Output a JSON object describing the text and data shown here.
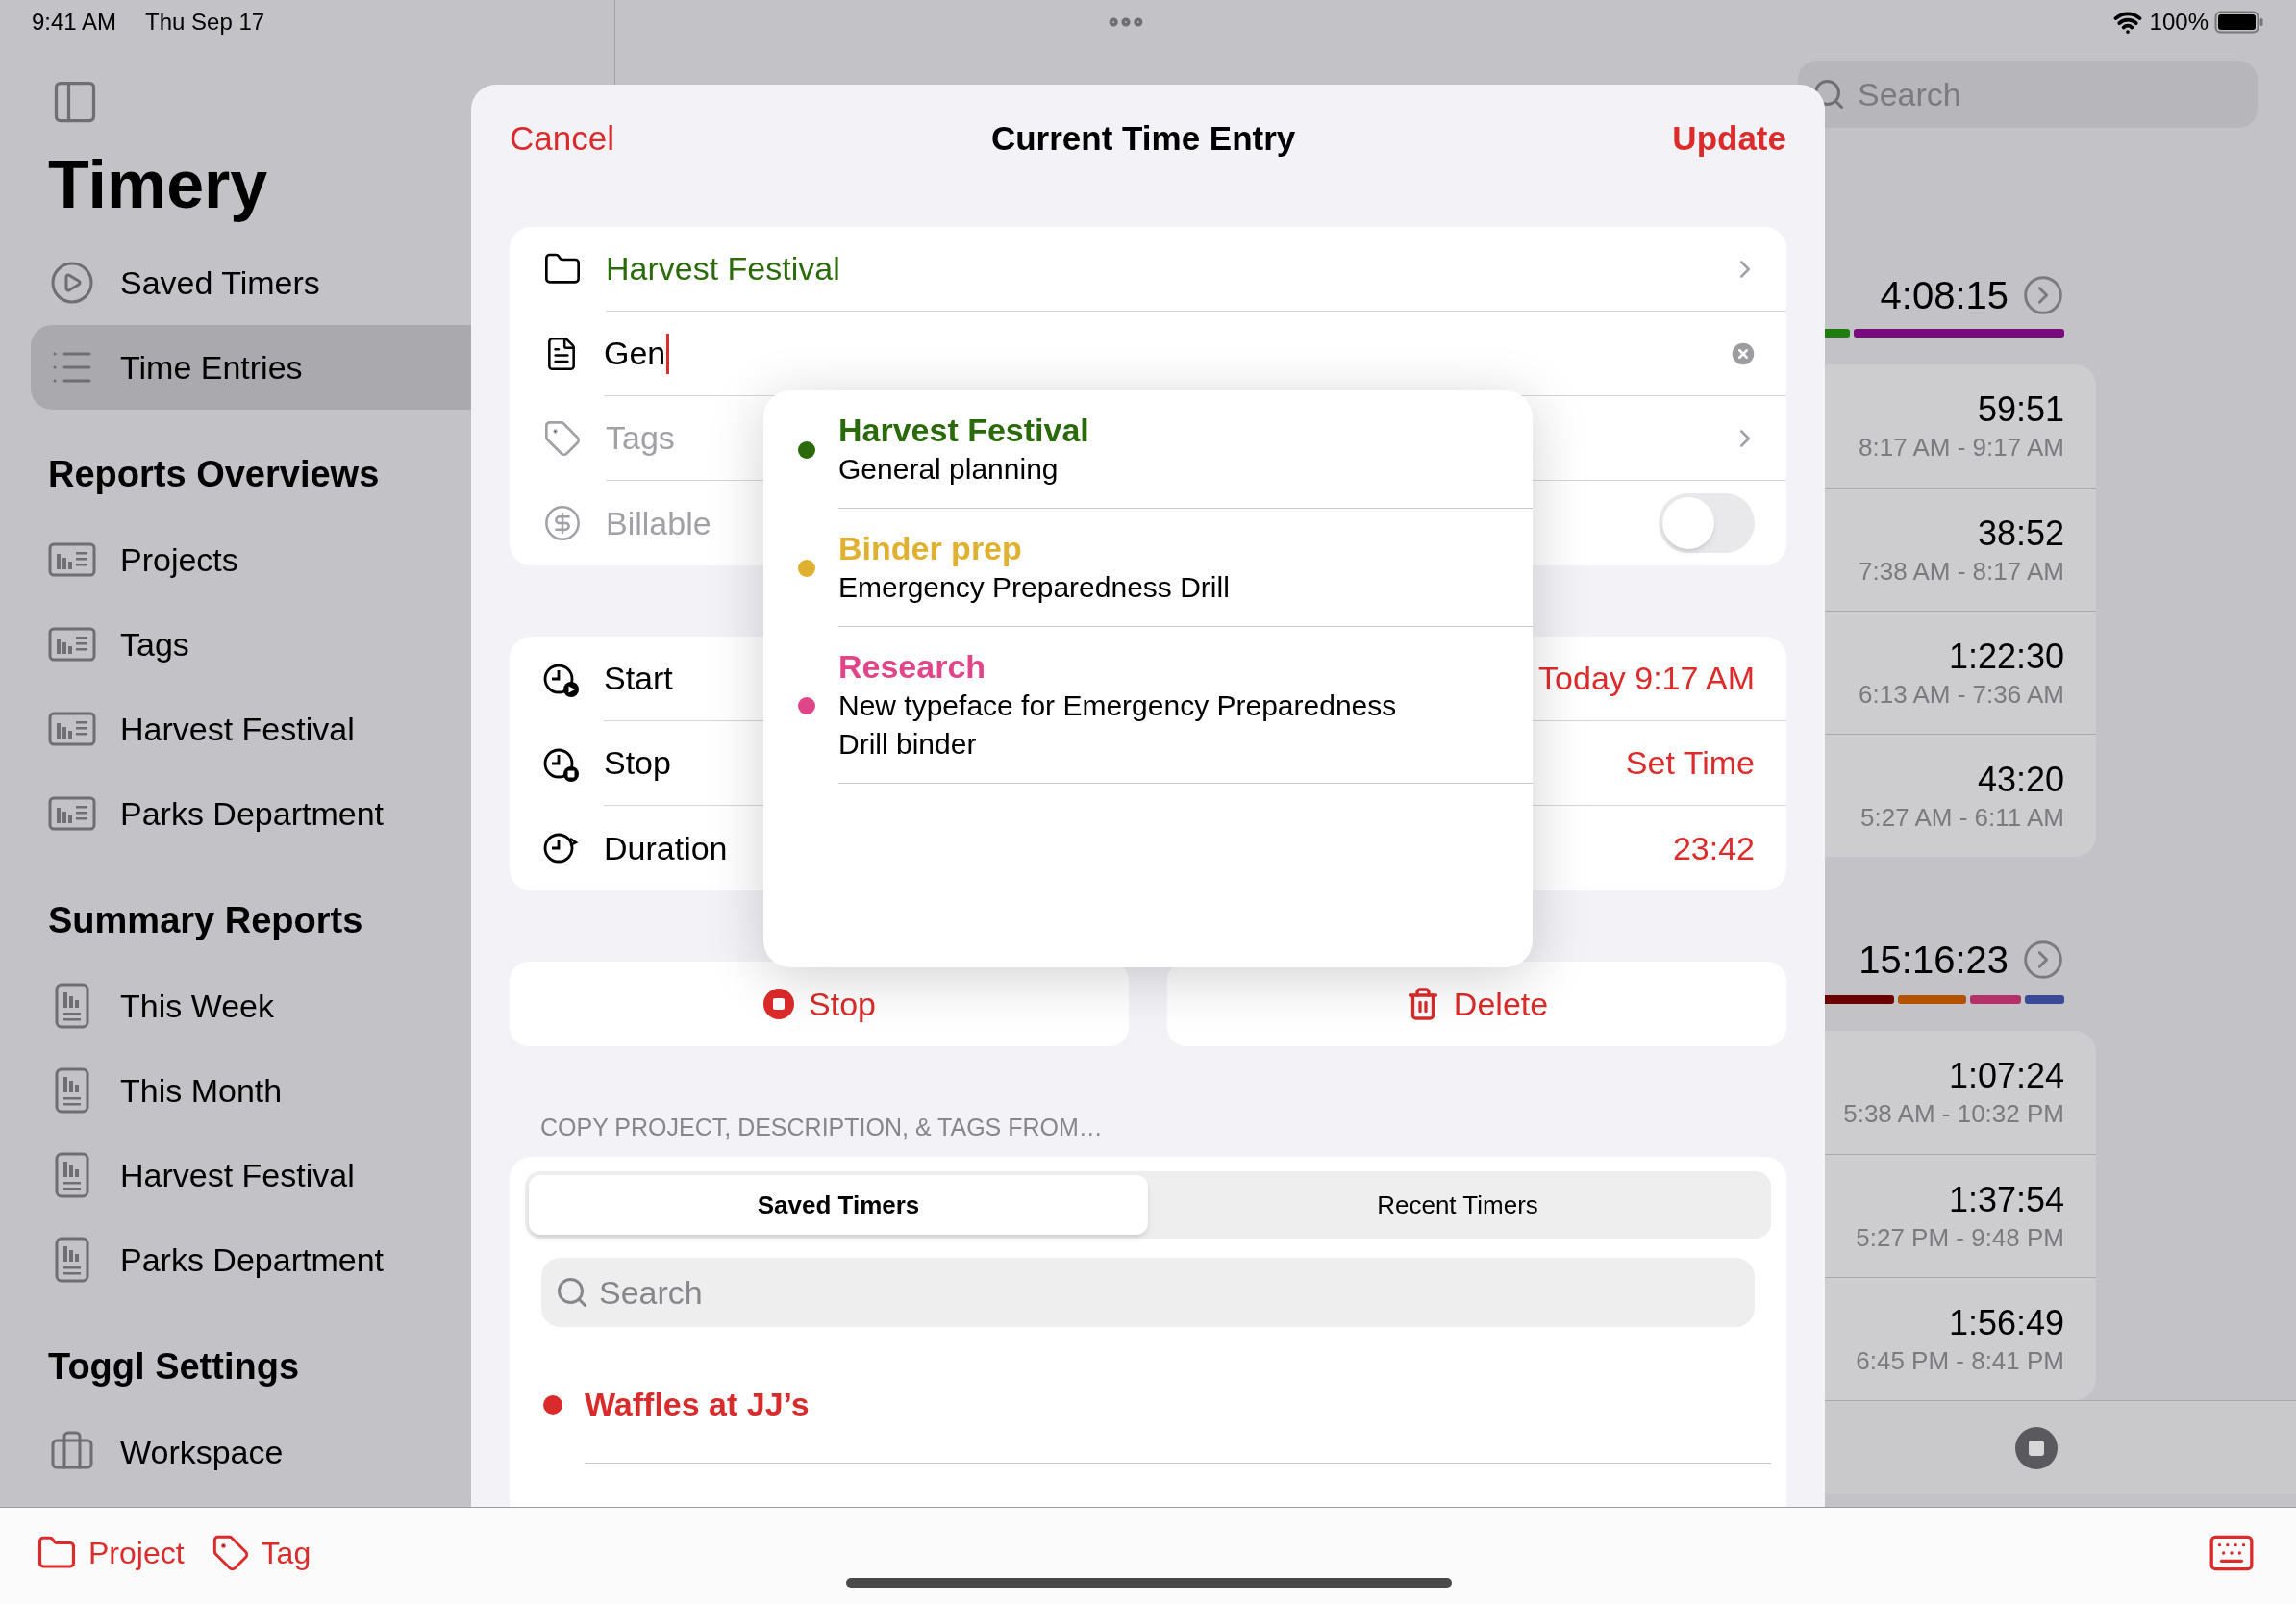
{
  "status_bar": {
    "time": "9:41 AM",
    "date": "Thu Sep 17",
    "battery": "100%"
  },
  "sidebar": {
    "title": "Timery",
    "items": [
      {
        "kind": "play",
        "label": "Saved Timers",
        "selected": false
      },
      {
        "kind": "list",
        "label": "Time Entries",
        "selected": true
      }
    ],
    "sections": [
      {
        "title": "Reports Overviews",
        "items": [
          {
            "kind": "overview",
            "label": "Projects",
            "selected": false
          },
          {
            "kind": "overview",
            "label": "Tags",
            "selected": false
          },
          {
            "kind": "overview",
            "label": "Harvest Festival",
            "selected": false
          },
          {
            "kind": "overview",
            "label": "Parks Department",
            "selected": false
          }
        ]
      },
      {
        "title": "Summary Reports",
        "items": [
          {
            "kind": "summary",
            "label": "This Week",
            "selected": false
          },
          {
            "kind": "summary",
            "label": "This Month",
            "selected": false
          },
          {
            "kind": "summary",
            "label": "Harvest Festival",
            "selected": false
          },
          {
            "kind": "summary",
            "label": "Parks Department",
            "selected": false
          }
        ]
      },
      {
        "title": "Toggl Settings",
        "items": [
          {
            "kind": "workspace",
            "label": "Workspace",
            "selected": false
          }
        ]
      }
    ]
  },
  "timeline": {
    "search": {
      "placeholder": "Search"
    },
    "days": [
      {
        "total": "4:08:15",
        "entries": [
          {
            "duration": "59:51",
            "range": "8:17 AM - 9:17 AM"
          },
          {
            "duration": "38:52",
            "range": "7:38 AM - 8:17 AM"
          },
          {
            "duration": "1:22:30",
            "range": "6:13 AM - 7:36 AM"
          },
          {
            "duration": "43:20",
            "range": "5:27 AM - 6:11 AM"
          }
        ]
      },
      {
        "total": "15:16:23",
        "entries": [
          {
            "duration": "1:07:24",
            "range": "5:38 AM - 10:32 PM"
          },
          {
            "duration": "1:37:54",
            "range": "5:27 PM - 9:48 PM"
          },
          {
            "duration": "1:56:49",
            "range": "6:45 PM - 8:41 PM"
          }
        ]
      }
    ]
  },
  "toolbar": {
    "items": [
      {
        "kind": "project",
        "label": "Project"
      },
      {
        "kind": "tag",
        "label": "Tag"
      }
    ]
  },
  "sheet": {
    "cancel": "Cancel",
    "title": "Current Time Entry",
    "update": "Update",
    "project": {
      "label": "Harvest Festival"
    },
    "description": {
      "value": "Gen"
    },
    "tags": {
      "placeholder": "Tags"
    },
    "billable": {
      "label": "Billable",
      "disabled": true,
      "on": false
    },
    "times": [
      {
        "kind": "start",
        "label": "Start",
        "value": "Today 9:17 AM"
      },
      {
        "kind": "stop",
        "label": "Stop",
        "value": "Set Time"
      },
      {
        "kind": "duration",
        "label": "Duration",
        "value": "23:42"
      }
    ],
    "actions": [
      {
        "kind": "stop",
        "label": "Stop"
      },
      {
        "kind": "delete",
        "label": "Delete"
      }
    ],
    "copy_header": "COPY PROJECT, DESCRIPTION, & TAGS FROM…",
    "tabs": [
      {
        "label": "Saved Timers",
        "selected": true
      },
      {
        "label": "Recent Timers",
        "selected": false
      }
    ],
    "search": {
      "placeholder": "Search"
    },
    "timers": [
      {
        "label": "Waffles at JJ’s",
        "color": "#d92b2b"
      }
    ]
  },
  "suggestions": [
    {
      "project": "Harvest Festival",
      "description": "General planning",
      "color": "#2a6a0a"
    },
    {
      "project": "Binder prep",
      "description": "Emergency Preparedness Drill",
      "color": "#e0b030"
    },
    {
      "project": "Research",
      "description": "New typeface for Emergency Preparedness Drill binder",
      "color": "#e0458a"
    }
  ]
}
